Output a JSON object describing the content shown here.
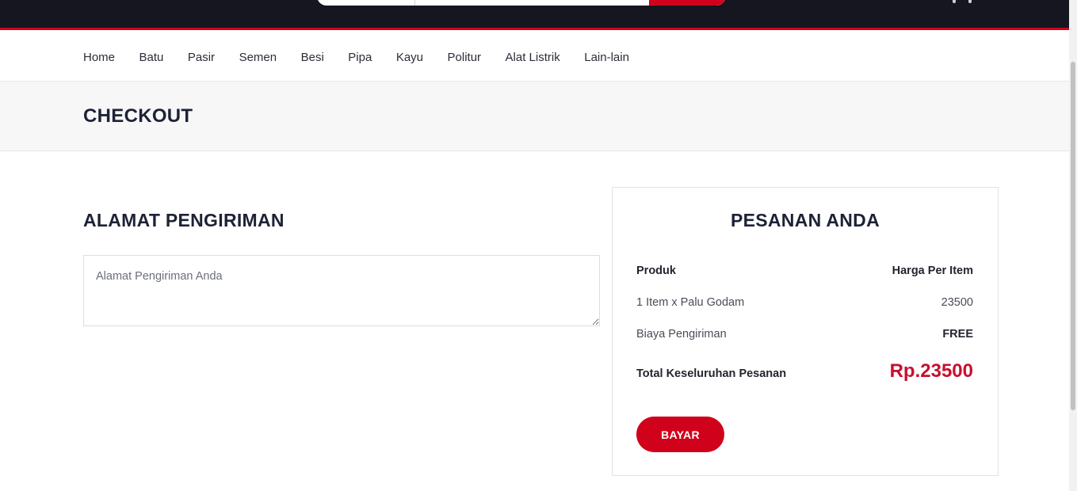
{
  "nav": {
    "items": [
      "Home",
      "Batu",
      "Pasir",
      "Semen",
      "Besi",
      "Pipa",
      "Kayu",
      "Politur",
      "Alat Listrik",
      "Lain-lain"
    ]
  },
  "page": {
    "title": "CHECKOUT"
  },
  "address": {
    "title": "ALAMAT PENGIRIMAN",
    "placeholder": "Alamat Pengiriman Anda"
  },
  "order": {
    "title": "PESANAN ANDA",
    "header_product": "Produk",
    "header_price": "Harga Per Item",
    "item_label": "1 Item x Palu Godam",
    "item_price": "23500",
    "shipping_label": "Biaya Pengiriman",
    "shipping_value": "FREE",
    "total_label": "Total Keseluruhan Pesanan",
    "total_value": "Rp.23500",
    "pay_label": "BAYAR"
  },
  "colors": {
    "accent": "#d0021b",
    "topbar": "#15161f",
    "heading": "#1d2235"
  }
}
